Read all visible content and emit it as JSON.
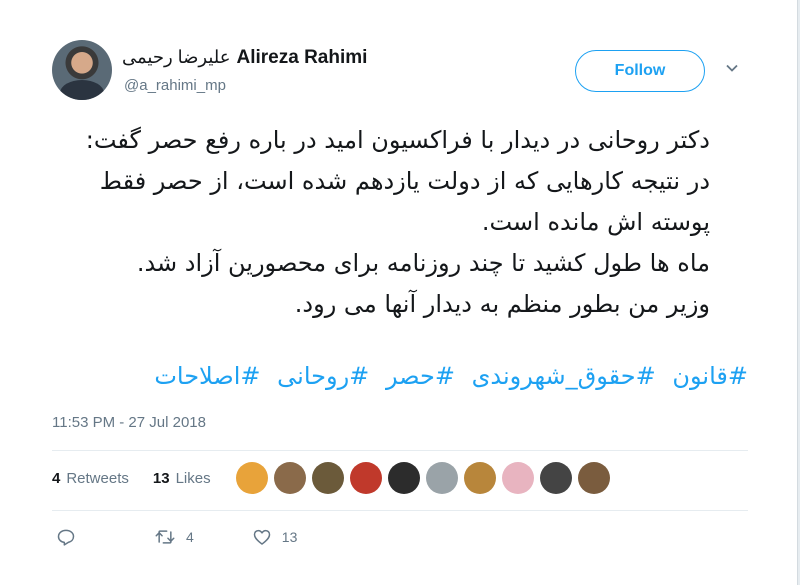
{
  "author": {
    "name_fa": "علیرضا رحیمی",
    "name_en": "Alireza Rahimi",
    "handle": "@a_rahimi_mp"
  },
  "follow_label": "Follow",
  "tweet": {
    "lines": [
      "دکتر روحانی در دیدار با فراکسیون امید در باره رفع حصر گفت: در نتیجه کارهایی که از دولت یازدهم شده است، از حصر فقط پوسته اش مانده است.",
      "ماه ها طول کشید تا چند روزنامه برای محصورین آزاد شد.",
      "وزیر من بطور منظم به دیدار آنها می رود."
    ],
    "hashtags": [
      "#قانون",
      "#حقوق_شهروندی",
      "#حصر",
      "#روحانی",
      "#اصلاحات"
    ]
  },
  "timestamp": "11:53 PM - 27 Jul 2018",
  "stats": {
    "retweets_count": "4",
    "retweets_label": "Retweets",
    "likes_count": "13",
    "likes_label": "Likes"
  },
  "liker_colors": [
    "#e8a33a",
    "#8a6a4a",
    "#6b5a3a",
    "#c0392b",
    "#2c2c2c",
    "#9aa3a8",
    "#b8863b",
    "#e8b4c0",
    "#444444",
    "#7a5c3e"
  ],
  "actions": {
    "reply_icon": "reply-icon",
    "retweet_icon": "retweet-icon",
    "retweet_count": "4",
    "like_icon": "heart-icon",
    "like_count": "13"
  },
  "colors": {
    "accent": "#1da1f2",
    "text": "#14171a",
    "muted": "#657786"
  }
}
